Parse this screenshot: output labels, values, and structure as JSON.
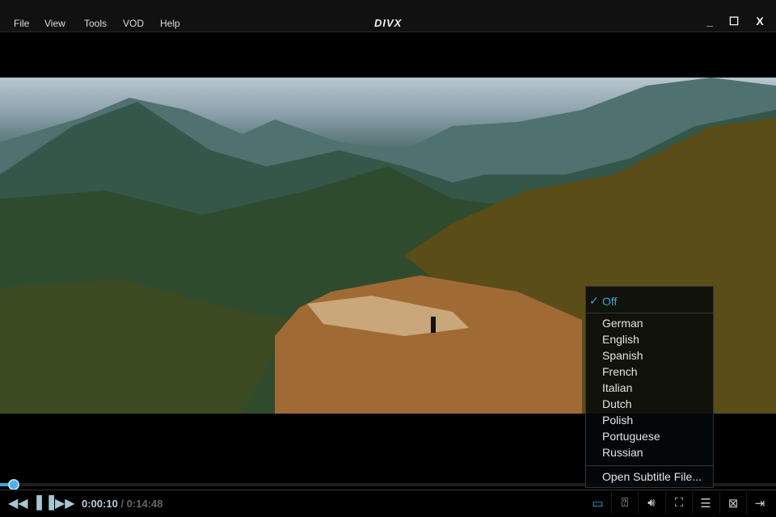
{
  "titlebar": {
    "menus": [
      "File",
      "View",
      "Tools",
      "VOD",
      "Help"
    ],
    "logo": "DIVX",
    "minimize": "_",
    "maximize": "☐",
    "close": "X"
  },
  "player": {
    "current_time": "0:00:10",
    "total_time": "/ 0:14:48",
    "progress_percent": 1.1
  },
  "subtitle_menu": {
    "checkmark": "✓",
    "selected": "Off",
    "languages": [
      "German",
      "English",
      "Spanish",
      "French",
      "Italian",
      "Dutch",
      "Polish",
      "Portuguese",
      "Russian"
    ],
    "open_file": "Open Subtitle File..."
  },
  "colors": {
    "accent": "#3aa6d8"
  }
}
